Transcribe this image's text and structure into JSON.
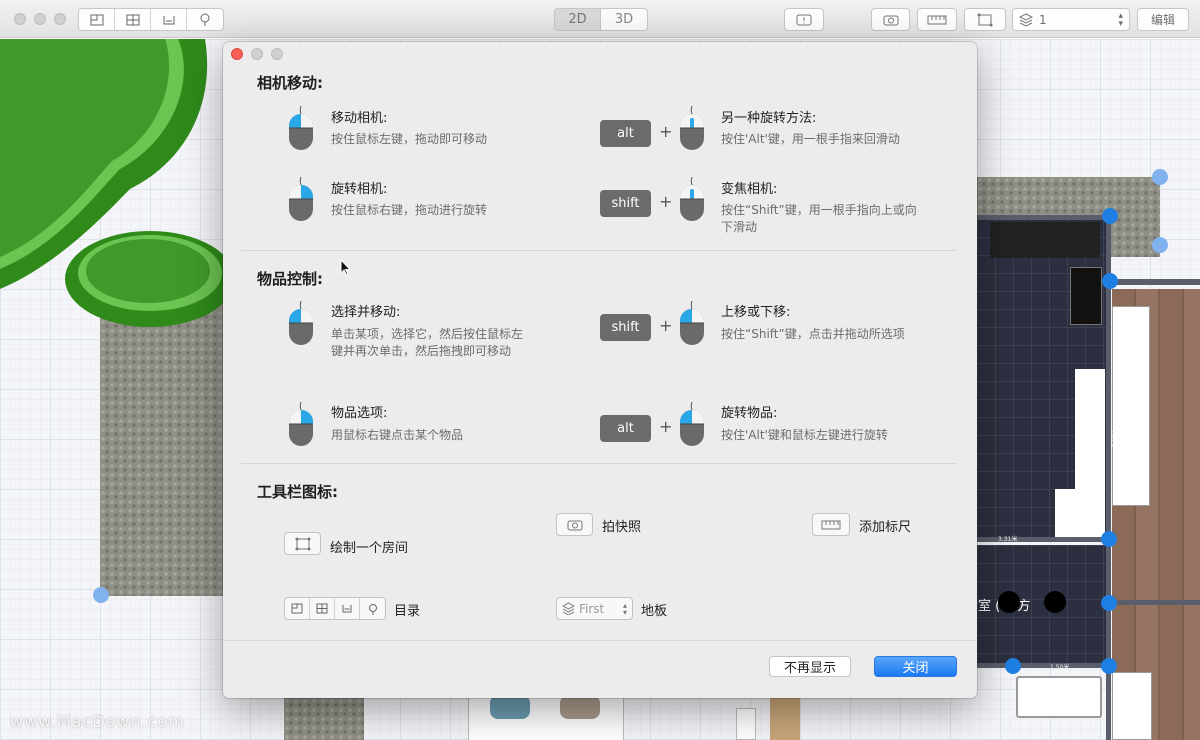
{
  "toolbar": {
    "view_2d": "2D",
    "view_3d": "3D",
    "layer_value": "1",
    "edit_label": "编辑",
    "icons": [
      "floorplan-icon",
      "grid-icon",
      "furniture-icon",
      "tree-icon",
      "warning-icon",
      "camera-icon",
      "ruler-icon",
      "draw-room-icon",
      "layers-icon"
    ]
  },
  "plan": {
    "dim_label_1": "3.31米",
    "dim_label_2": "1.50米",
    "dim_label_3": "5.82米",
    "room_label": "室 (  平方"
  },
  "dialog": {
    "sections": {
      "camera": "相机移动:",
      "objects": "物品控制:",
      "toolbar": "工具栏图标:"
    },
    "camera_items": [
      {
        "title": "移动相机:",
        "desc": "按住鼠标左键，拖动即可移动"
      },
      {
        "title": "另一种旋转方法:",
        "desc": "按住'Alt'键，用一根手指来回滑动",
        "key": "alt"
      },
      {
        "title": "旋转相机:",
        "desc": "按住鼠标右键，拖动进行旋转"
      },
      {
        "title": "变焦相机:",
        "desc": "按住“Shift”键，用一根手指向上或向下滑动",
        "key": "shift"
      }
    ],
    "object_items": [
      {
        "title": "选择并移动:",
        "desc": "单击某项，选择它，然后按住鼠标左键并再次单击，然后拖拽即可移动"
      },
      {
        "title": "上移或下移:",
        "desc": "按住“Shift”键，点击并拖动所选项",
        "key": "shift"
      },
      {
        "title": "物品选项:",
        "desc": "用鼠标右键点击某个物品"
      },
      {
        "title": "旋转物品:",
        "desc": "按住'Alt'键和鼠标左键进行旋转",
        "key": "alt"
      }
    ],
    "toolbar_items": {
      "snapshot": "拍快照",
      "ruler": "添加标尺",
      "draw_room": "绘制一个房间",
      "catalog": "目录",
      "floor": "地板",
      "floor_select": "First"
    },
    "buttons": {
      "dont_show": "不再显示",
      "close": "关闭"
    }
  },
  "watermark": "www.MacDown.com",
  "colors": {
    "accent": "#1b79f2",
    "mouse_highlight": "#2aa7e6",
    "key_bg": "#6b6b6b",
    "node_blue": "#1f7fe3",
    "tree_green": "#2f8a1a"
  }
}
